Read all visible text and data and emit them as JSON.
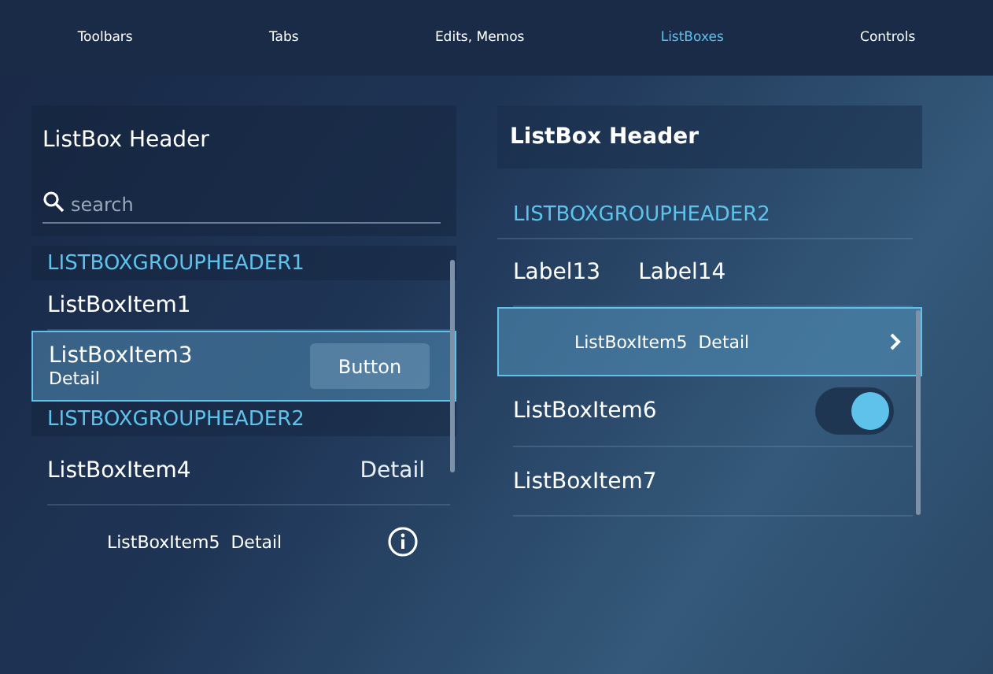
{
  "nav": [
    {
      "label": "Toolbars",
      "selected": false
    },
    {
      "label": "Tabs",
      "selected": false
    },
    {
      "label": "Edits, Memos",
      "selected": false
    },
    {
      "label": "ListBoxes",
      "selected": true
    },
    {
      "label": "Controls",
      "selected": false
    }
  ],
  "left": {
    "header": "ListBox Header",
    "search": {
      "placeholder": "search"
    },
    "items": [
      {
        "kind": "group",
        "text": "LISTBOXGROUPHEADER1"
      },
      {
        "kind": "plain",
        "text": "ListBoxItem1",
        "selected": false
      },
      {
        "kind": "button",
        "text": "ListBoxItem3",
        "detail": "Detail",
        "button": "Button",
        "selected": true
      },
      {
        "kind": "group",
        "text": "LISTBOXGROUPHEADER2"
      },
      {
        "kind": "detail",
        "text": "ListBoxItem4",
        "detail": "Detail",
        "selected": false
      },
      {
        "kind": "info",
        "text": "ListBoxItem5  Detail",
        "selected": false
      }
    ]
  },
  "right": {
    "header": "ListBox Header",
    "items": [
      {
        "kind": "group",
        "text": "LISTBOXGROUPHEADER2"
      },
      {
        "kind": "labels",
        "labels": [
          "Label13",
          "Label14"
        ],
        "selected": false
      },
      {
        "kind": "chevron",
        "text": "ListBoxItem5  Detail",
        "selected": true
      },
      {
        "kind": "toggle",
        "text": "ListBoxItem6",
        "on": true,
        "selected": false
      },
      {
        "kind": "plain",
        "text": "ListBoxItem7",
        "selected": false
      }
    ]
  }
}
